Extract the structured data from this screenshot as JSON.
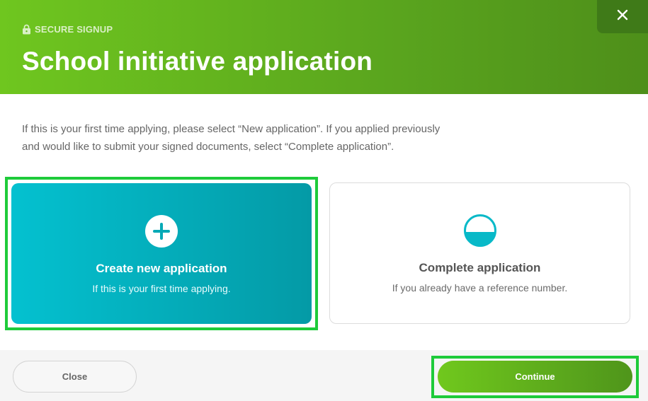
{
  "header": {
    "eyebrow": "SECURE SIGNUP",
    "eyebrow_icon": "lock-icon",
    "title": "School initiative application",
    "close_icon": "close-icon"
  },
  "intro": {
    "line1": "If this is your first time applying, please select “New application”. If you applied previously",
    "line2": "and would like to submit your signed documents, select “Complete application”."
  },
  "options": [
    {
      "title": "Create new application",
      "subtitle": "If this is your first time applying.",
      "icon": "plus-circle-icon",
      "selected": true
    },
    {
      "title": "Complete application",
      "subtitle": "If you already have a reference number.",
      "icon": "half-circle-icon",
      "selected": false
    }
  ],
  "footer": {
    "close_label": "Close",
    "continue_label": "Continue"
  },
  "colors": {
    "brand_green": "#6fc61f",
    "teal": "#04b3c0",
    "highlight": "#1ecb3a"
  }
}
